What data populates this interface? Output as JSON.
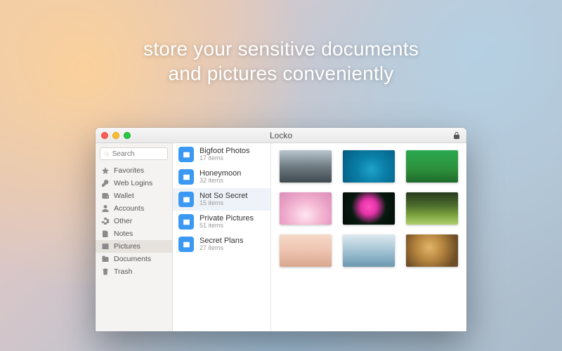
{
  "tagline": {
    "line1": "store your sensitive documents",
    "line2": "and pictures conveniently"
  },
  "window": {
    "title": "Locko"
  },
  "search": {
    "placeholder": "Search"
  },
  "sidebar": {
    "items": [
      {
        "label": "Favorites"
      },
      {
        "label": "Web Logins"
      },
      {
        "label": "Wallet"
      },
      {
        "label": "Accounts"
      },
      {
        "label": "Other"
      },
      {
        "label": "Notes"
      },
      {
        "label": "Pictures"
      },
      {
        "label": "Documents"
      },
      {
        "label": "Trash"
      }
    ],
    "selected_index": 6
  },
  "albums": {
    "items": [
      {
        "name": "Bigfoot Photos",
        "count": "17 items"
      },
      {
        "name": "Honeymoon",
        "count": "32 items"
      },
      {
        "name": "Not So Secret",
        "count": "15 items"
      },
      {
        "name": "Private Pictures",
        "count": "51 items"
      },
      {
        "name": "Secret Plans",
        "count": "27 items"
      }
    ],
    "selected_index": 2
  }
}
